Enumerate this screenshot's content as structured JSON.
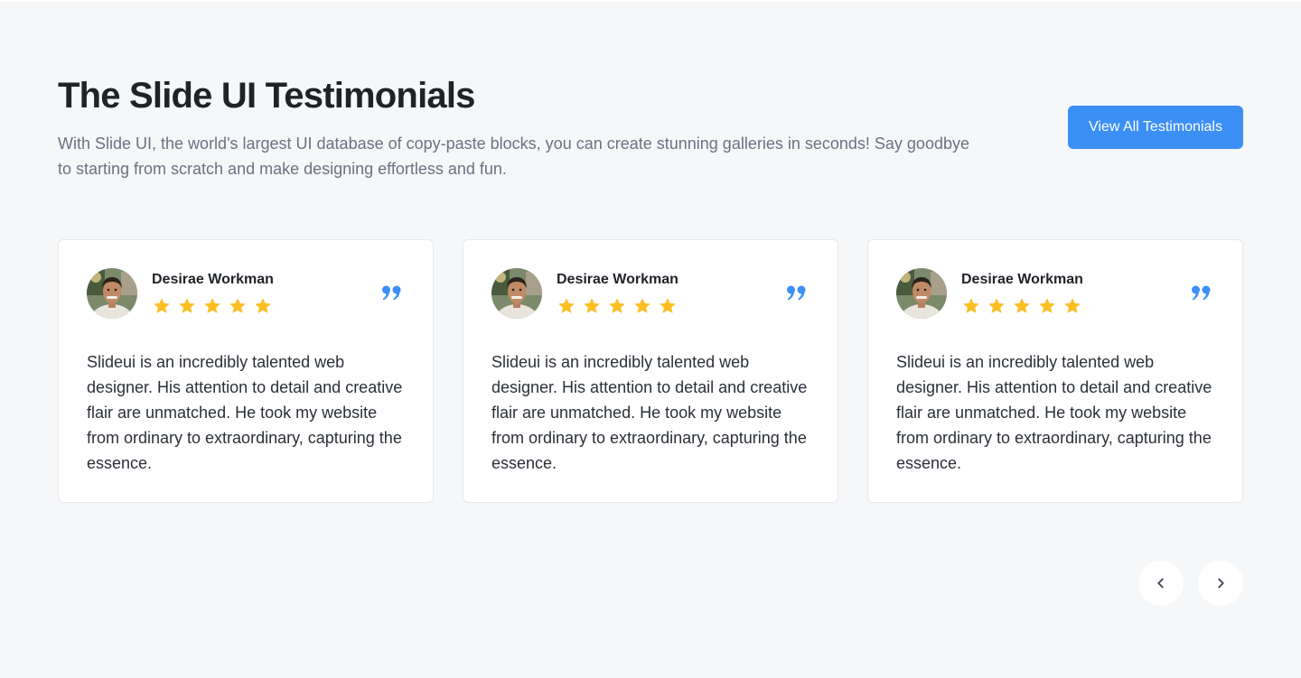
{
  "header": {
    "title": "The Slide UI Testimonials",
    "subtitle": "With Slide UI, the world's largest UI database of copy-paste blocks, you can create stunning galleries in seconds! Say goodbye to starting from scratch and make designing effortless and fun.",
    "cta_label": "View All Testimonials"
  },
  "colors": {
    "accent": "#3b8ff5",
    "star": "#fbbf24",
    "background": "#f6f7f9"
  },
  "testimonials": [
    {
      "name": "Desirae Workman",
      "rating": 5,
      "text": "Slideui is an incredibly talented web designer. His attention to detail and creative flair are unmatched. He took my website from ordinary to extraordinary, capturing the essence."
    },
    {
      "name": "Desirae Workman",
      "rating": 5,
      "text": "Slideui is an incredibly talented web designer. His attention to detail and creative flair are unmatched. He took my website from ordinary to extraordinary, capturing the essence."
    },
    {
      "name": "Desirae Workman",
      "rating": 5,
      "text": "Slideui is an incredibly talented web designer. His attention to detail and creative flair are unmatched. He took my website from ordinary to extraordinary, capturing the essence."
    }
  ],
  "icons": {
    "quote": "quote-icon",
    "star": "star-icon",
    "prev": "chevron-left-icon",
    "next": "chevron-right-icon"
  }
}
